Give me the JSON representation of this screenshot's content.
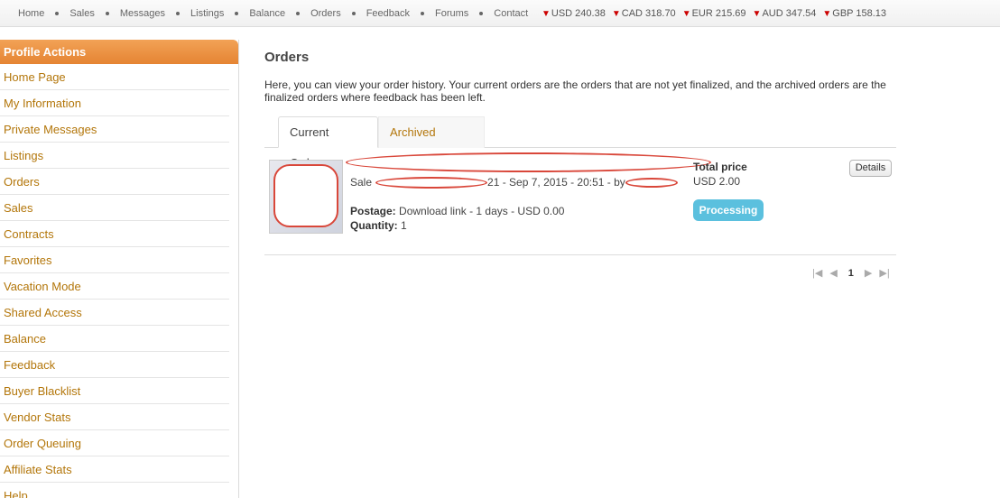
{
  "topnav": {
    "items": [
      "Home",
      "Sales",
      "Messages",
      "Listings",
      "Balance",
      "Orders",
      "Feedback",
      "Forums",
      "Contact"
    ]
  },
  "rates": [
    {
      "label": "USD 240.38",
      "trend": "down"
    },
    {
      "label": "CAD 318.70",
      "trend": "down"
    },
    {
      "label": "EUR 215.69",
      "trend": "down"
    },
    {
      "label": "AUD 347.54",
      "trend": "down"
    },
    {
      "label": "GBP 158.13",
      "trend": "down"
    }
  ],
  "sidebar": {
    "header": "Profile Actions",
    "items": [
      "Home Page",
      "My Information",
      "Private Messages",
      "Listings",
      "Orders",
      "Sales",
      "Contracts",
      "Favorites",
      "Vacation Mode",
      "Shared Access",
      "Balance",
      "Feedback",
      "Buyer Blacklist",
      "Vendor Stats",
      "Order Queuing",
      "Affiliate Stats",
      "Help"
    ]
  },
  "main": {
    "title": "Orders",
    "intro": "Here, you can view your order history. Your current orders are the orders that are not yet finalized, and the archived orders are the finalized orders where feedback has been left.",
    "tabs": {
      "current": "Current Orders",
      "archived": "Archived Orders"
    }
  },
  "order": {
    "sale_prefix": "Sale",
    "sale_suffix": "21 - Sep 7, 2015 - 20:51 - by",
    "postage_label": "Postage:",
    "postage_value": "Download link - 1 days - USD 0.00",
    "quantity_label": "Quantity:",
    "quantity_value": "1",
    "total_label": "Total price",
    "total_value": "USD 2.00",
    "status": "Processing",
    "details_label": "Details"
  },
  "pager": {
    "current_page": "1"
  },
  "colors": {
    "accent": "#e58433",
    "link": "#b3760a",
    "status": "#5bc0de",
    "redaction": "#d9473a"
  }
}
